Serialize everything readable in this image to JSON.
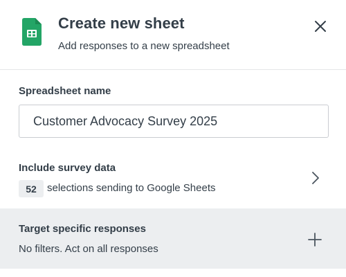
{
  "header": {
    "title": "Create new sheet",
    "subtitle": "Add responses to a new spreadsheet",
    "icon": "google-sheets-icon",
    "close_icon": "close-icon"
  },
  "spreadsheet_name": {
    "label": "Spreadsheet name",
    "value": "Customer Advocacy Survey 2025"
  },
  "survey_data": {
    "title": "Include survey data",
    "count": "52",
    "description": "selections sending to Google Sheets",
    "icon": "chevron-right-icon"
  },
  "target_responses": {
    "title": "Target specific responses",
    "description": "No filters. Act on all responses",
    "icon": "plus-icon"
  },
  "colors": {
    "sheets_green": "#23a566",
    "text": "#333e48",
    "row_bg": "#eceef0",
    "border": "#c9ccd1"
  }
}
